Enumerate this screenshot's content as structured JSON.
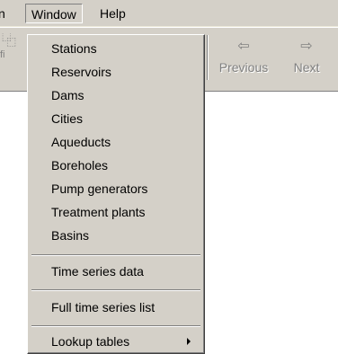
{
  "menubar": {
    "partial_label": "n",
    "window_label": "Window",
    "help_label": "Help"
  },
  "toolbar": {
    "partial_glyph": "⿻",
    "partial_label": "fi",
    "previous_label": "Previous",
    "next_label": "Next",
    "previous_glyph": "⇦",
    "next_glyph": "⇨"
  },
  "window_menu": {
    "items": [
      {
        "label": "Stations"
      },
      {
        "label": "Reservoirs"
      },
      {
        "label": "Dams"
      },
      {
        "label": "Cities"
      },
      {
        "label": "Aqueducts"
      },
      {
        "label": "Boreholes"
      },
      {
        "label": "Pump generators"
      },
      {
        "label": "Treatment plants"
      },
      {
        "label": "Basins"
      },
      {
        "label": "Time series data"
      },
      {
        "label": "Full time series list"
      },
      {
        "label": "Lookup tables",
        "has_submenu": true
      }
    ]
  },
  "colors": {
    "face": "#d4d0c8",
    "shadow": "#808080",
    "highlight": "#ffffff",
    "disabled_text": "#808080"
  }
}
